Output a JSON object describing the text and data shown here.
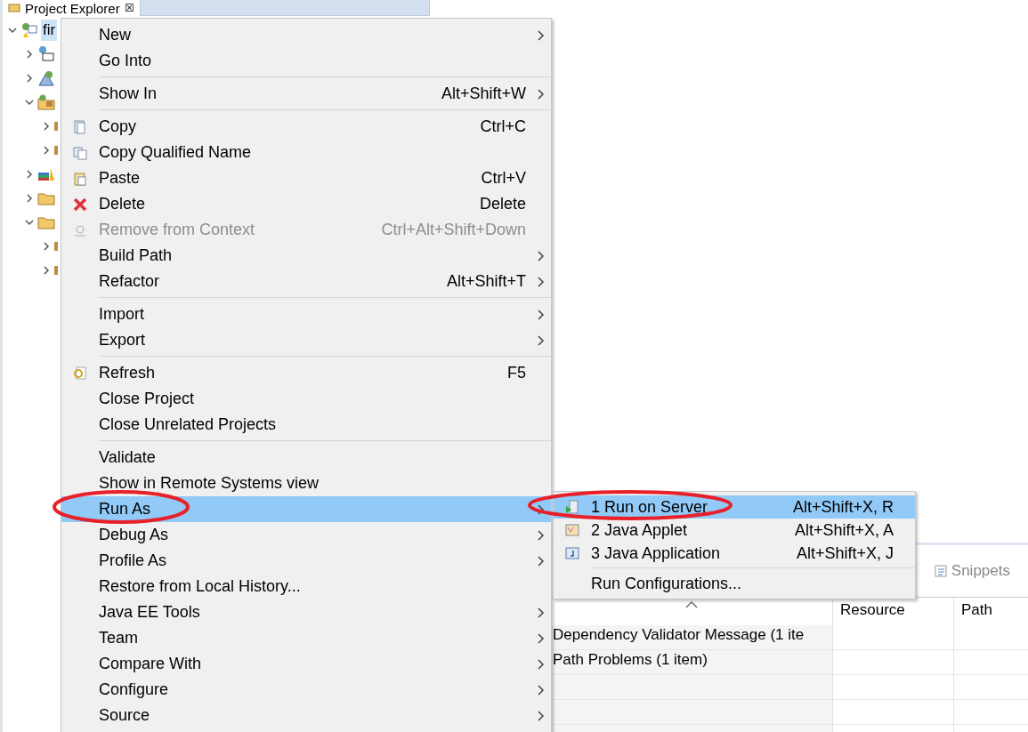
{
  "explorer": {
    "title": "Project Explorer",
    "close": "☒",
    "tree": [
      {
        "label": "fir",
        "kind": "project",
        "expanded": true,
        "selected": true,
        "children": [
          {
            "kind": "descriptor",
            "expanded": false,
            "selected": false
          },
          {
            "kind": "service",
            "expanded": false,
            "selected": false
          },
          {
            "kind": "package-folder",
            "expanded": true,
            "selected": false,
            "children": [
              {
                "kind": "stub",
                "expanded": false,
                "selected": false
              },
              {
                "kind": "stub",
                "expanded": false,
                "selected": false
              }
            ]
          },
          {
            "kind": "library",
            "expanded": false,
            "selected": false
          },
          {
            "kind": "folder",
            "expanded": false,
            "selected": false
          },
          {
            "kind": "folder",
            "expanded": true,
            "selected": false,
            "children": [
              {
                "kind": "stub",
                "expanded": false,
                "selected": false
              },
              {
                "kind": "stub",
                "expanded": false,
                "selected": false
              }
            ]
          }
        ]
      }
    ]
  },
  "context_menu": {
    "items": [
      {
        "kind": "item",
        "label": "New",
        "submenu": true,
        "disabled": false,
        "selected": false
      },
      {
        "kind": "item",
        "label": "Go Into",
        "submenu": false,
        "disabled": false,
        "selected": false
      },
      {
        "kind": "separator"
      },
      {
        "kind": "item",
        "label": "Show In",
        "shortcut": "Alt+Shift+W",
        "submenu": true,
        "disabled": false,
        "selected": false
      },
      {
        "kind": "separator"
      },
      {
        "kind": "copy",
        "label": "Copy",
        "shortcut": "Ctrl+C",
        "submenu": false,
        "disabled": false,
        "selected": false
      },
      {
        "kind": "copy-name",
        "label": "Copy Qualified Name",
        "submenu": false,
        "disabled": false,
        "selected": false
      },
      {
        "kind": "paste",
        "label": "Paste",
        "shortcut": "Ctrl+V",
        "submenu": false,
        "disabled": false,
        "selected": false
      },
      {
        "kind": "delete",
        "label": "Delete",
        "shortcut": "Delete",
        "submenu": false,
        "disabled": false,
        "selected": false
      },
      {
        "kind": "remove",
        "label": "Remove from Context",
        "shortcut": "Ctrl+Alt+Shift+Down",
        "submenu": false,
        "disabled": true,
        "selected": false
      },
      {
        "kind": "item",
        "label": "Build Path",
        "submenu": true,
        "disabled": false,
        "selected": false
      },
      {
        "kind": "item",
        "label": "Refactor",
        "shortcut": "Alt+Shift+T",
        "submenu": true,
        "disabled": false,
        "selected": false
      },
      {
        "kind": "separator"
      },
      {
        "kind": "item",
        "label": "Import",
        "submenu": true,
        "disabled": false,
        "selected": false
      },
      {
        "kind": "item",
        "label": "Export",
        "submenu": true,
        "disabled": false,
        "selected": false
      },
      {
        "kind": "separator"
      },
      {
        "kind": "refresh",
        "label": "Refresh",
        "shortcut": "F5",
        "submenu": false,
        "disabled": false,
        "selected": false
      },
      {
        "kind": "item",
        "label": "Close Project",
        "submenu": false,
        "disabled": false,
        "selected": false
      },
      {
        "kind": "item",
        "label": "Close Unrelated Projects",
        "submenu": false,
        "disabled": false,
        "selected": false
      },
      {
        "kind": "separator"
      },
      {
        "kind": "item",
        "label": "Validate",
        "submenu": false,
        "disabled": false,
        "selected": false
      },
      {
        "kind": "item",
        "label": "Show in Remote Systems view",
        "submenu": false,
        "disabled": false,
        "selected": false
      },
      {
        "kind": "item",
        "label": "Run As",
        "submenu": true,
        "disabled": false,
        "selected": true
      },
      {
        "kind": "item",
        "label": "Debug As",
        "submenu": true,
        "disabled": false,
        "selected": false
      },
      {
        "kind": "item",
        "label": "Profile As",
        "submenu": true,
        "disabled": false,
        "selected": false
      },
      {
        "kind": "item",
        "label": "Restore from Local History...",
        "submenu": false,
        "disabled": false,
        "selected": false
      },
      {
        "kind": "item",
        "label": "Java EE Tools",
        "submenu": true,
        "disabled": false,
        "selected": false
      },
      {
        "kind": "item",
        "label": "Team",
        "submenu": true,
        "disabled": false,
        "selected": false
      },
      {
        "kind": "item",
        "label": "Compare With",
        "submenu": true,
        "disabled": false,
        "selected": false
      },
      {
        "kind": "item",
        "label": "Configure",
        "submenu": true,
        "disabled": false,
        "selected": false
      },
      {
        "kind": "item",
        "label": "Source",
        "submenu": true,
        "disabled": false,
        "selected": false
      }
    ]
  },
  "run_as_submenu": {
    "items": [
      {
        "kind": "server",
        "label": "1 Run on Server",
        "shortcut": "Alt+Shift+X, R",
        "selected": true
      },
      {
        "kind": "applet",
        "label": "2 Java Applet",
        "shortcut": "Alt+Shift+X, A",
        "selected": false
      },
      {
        "kind": "application",
        "label": "3 Java Application",
        "shortcut": "Alt+Shift+X, J",
        "selected": false
      },
      {
        "kind": "separator"
      },
      {
        "kind": "item",
        "label": "Run Configurations...",
        "selected": false
      }
    ]
  },
  "bottom_panel": {
    "tabs": [
      {
        "label": "Snippets",
        "selected": false
      }
    ],
    "table": {
      "columns": [
        {
          "sorted": true
        },
        {
          "label": "Resource"
        },
        {
          "label": "Path"
        }
      ],
      "rows": [
        [
          "Dependency Validator Message (1 ite",
          "",
          ""
        ],
        [
          "Path Problems (1 item)",
          "",
          ""
        ],
        [
          "",
          "",
          ""
        ],
        [
          "",
          "",
          ""
        ],
        [
          "",
          "",
          ""
        ]
      ]
    }
  }
}
